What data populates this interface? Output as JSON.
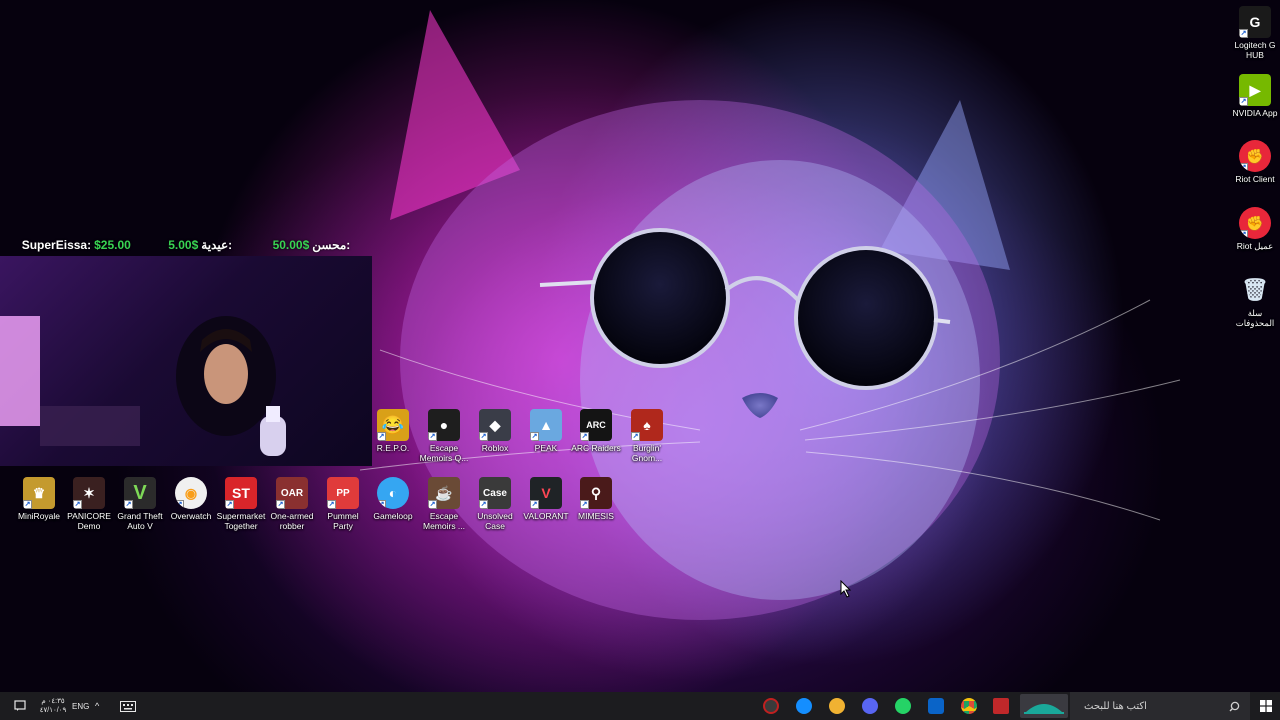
{
  "donations": [
    {
      "name": "SuperEissa:",
      "amount": "$25.00"
    },
    {
      "name": "عيدية:",
      "amount": "5.00$"
    },
    {
      "name": "محسن:",
      "amount": "50.00$"
    }
  ],
  "icons": {
    "right": [
      {
        "label": "Logitech G HUB",
        "icon": "logitech-g-icon",
        "color": "#1a1a1a"
      },
      {
        "label": "NVIDIA App",
        "icon": "nvidia-icon",
        "color": "#76b900"
      },
      {
        "label": "Riot Client",
        "icon": "riot-icon",
        "color": "#e8273a"
      },
      {
        "label": "Riot عميل",
        "icon": "riot-icon",
        "color": "#e8273a"
      },
      {
        "label": "سلة المحذوفات",
        "icon": "recycle-bin-icon",
        "color": "#d8e6f2"
      }
    ],
    "row1": [
      {
        "label": "R.E.P.O.",
        "icon": "repo-icon",
        "color": "#d9a018"
      },
      {
        "label": "Escape Memoirs Q...",
        "icon": "escape-memoirs-icon",
        "color": "#1e1e1e"
      },
      {
        "label": "Roblox",
        "icon": "roblox-icon",
        "color": "#3a3d48"
      },
      {
        "label": "PEAK",
        "icon": "peak-icon",
        "color": "#6aa8e0"
      },
      {
        "label": "ARC Raiders",
        "icon": "arc-raiders-icon",
        "color": "#141414"
      },
      {
        "label": "Burglin' Gnom...",
        "icon": "burglin-gnomes-icon",
        "color": "#b0281c"
      }
    ],
    "row2": [
      {
        "label": "MiniRoyale",
        "icon": "miniroyale-icon",
        "color": "#c49a2e"
      },
      {
        "label": "PANICORE Demo",
        "icon": "panicore-icon",
        "color": "#3a2020"
      },
      {
        "label": "Grand Theft Auto V",
        "icon": "gta-v-icon",
        "color": "#2b2b2b"
      },
      {
        "label": "Overwatch",
        "icon": "overwatch-icon",
        "color": "#f0f0f0"
      },
      {
        "label": "Supermarket Together",
        "icon": "supermarket-together-icon",
        "color": "#d9252a"
      },
      {
        "label": "One-armed robber",
        "icon": "one-armed-robber-icon",
        "color": "#8a3030"
      },
      {
        "label": "Pummel Party",
        "icon": "pummel-party-icon",
        "color": "#e03b3b"
      },
      {
        "label": "Gameloop",
        "icon": "gameloop-icon",
        "color": "#35a6f2"
      },
      {
        "label": "Escape Memoirs ...",
        "icon": "escape-memoirs-icon",
        "color": "#6a4a36"
      },
      {
        "label": "Unsolved Case",
        "icon": "unsolved-case-icon",
        "color": "#3a3a3a"
      },
      {
        "label": "VALORANT",
        "icon": "valorant-icon",
        "color": "#1f2326"
      },
      {
        "label": "MIMESIS",
        "icon": "mimesis-icon",
        "color": "#4a1a1a"
      }
    ]
  },
  "taskbar": {
    "clock_time": "٠٤:٣٥ م",
    "clock_date": "٤٧/١٠/٠٩",
    "lang": "ENG",
    "search_placeholder": "اكتب هنا للبحث",
    "apps": [
      {
        "icon": "obs-icon",
        "color": "#3a3a3a"
      },
      {
        "icon": "battlenet-icon",
        "color": "#148eff"
      },
      {
        "icon": "discord-alt-icon",
        "color": "#f0b232"
      },
      {
        "icon": "discord-icon",
        "color": "#5865f2"
      },
      {
        "icon": "whatsapp-icon",
        "color": "#25d366"
      },
      {
        "icon": "mail-icon",
        "color": "#0a64c8"
      },
      {
        "icon": "chrome-icon",
        "color": "#dd4b39"
      },
      {
        "icon": "media-app-icon",
        "color": "#c0282a"
      }
    ]
  }
}
